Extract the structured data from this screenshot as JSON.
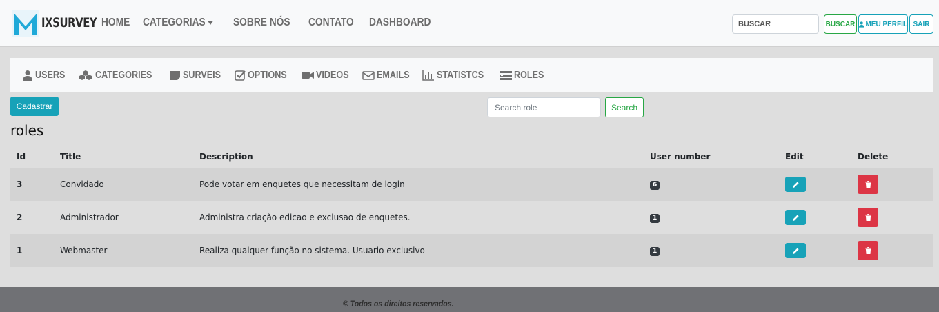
{
  "brand": {
    "letter": "M",
    "name": "IXSURVEY",
    "accent": "#1fa9d8"
  },
  "nav": {
    "home": "HOME",
    "categorias": "CATEGORIAS",
    "sobre": "SOBRE NÓS",
    "contato": "CONTATO",
    "dashboard": "DASHBOARD"
  },
  "top_search": {
    "placeholder": "BUSCAR"
  },
  "top_buttons": {
    "buscar": "BUSCAR",
    "perfil": "MEU PERFIL",
    "sair": "SAIR"
  },
  "subnav": {
    "users": "USERS",
    "categories": "CATEGORIES",
    "surveis": "SURVEIS",
    "options": "OPTIONS",
    "videos": "VIDEOS",
    "emails": "EMAILS",
    "statistcs": "STATISTCS",
    "roles": "ROLES"
  },
  "actions": {
    "cadastrar": "Cadastrar",
    "search_placeholder": "Search role",
    "search": "Search"
  },
  "page_title": "roles",
  "table": {
    "headers": {
      "id": "Id",
      "title": "Title",
      "description": "Description",
      "user_number": "User number",
      "edit": "Edit",
      "delete": "Delete"
    },
    "rows": [
      {
        "id": "3",
        "title": "Convidado",
        "description": "Pode votar em enquetes que necessitam de login",
        "users": "6"
      },
      {
        "id": "2",
        "title": "Administrador",
        "description": "Administra criação edicao e exclusao de enquetes.",
        "users": "1"
      },
      {
        "id": "1",
        "title": "Webmaster",
        "description": "Realiza qualquer função no sistema. Usuario exclusivo",
        "users": "1"
      }
    ]
  },
  "footer": "© Todos os direitos reservados.",
  "colors": {
    "info": "#17a2b8",
    "success": "#28a745",
    "danger": "#dc3545",
    "dark": "#343a40"
  }
}
